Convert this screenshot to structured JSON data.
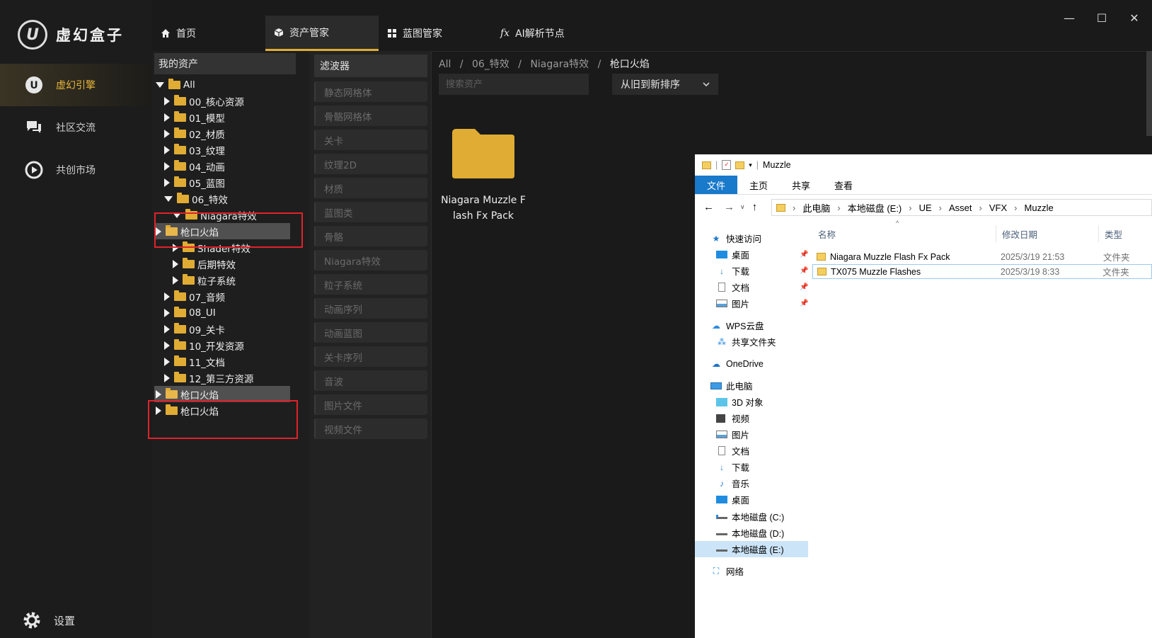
{
  "app": {
    "name": "虚幻盒子",
    "logo_glyph": "U"
  },
  "leftnav": {
    "items": [
      {
        "label": "虚幻引擎",
        "icon": "unreal-icon",
        "active": true
      },
      {
        "label": "社区交流",
        "icon": "chat-icon",
        "active": false
      },
      {
        "label": "共创市场",
        "icon": "market-icon",
        "active": false
      }
    ],
    "settings_label": "设置"
  },
  "tabs": [
    {
      "label": "首页",
      "icon": "home-icon",
      "active": false
    },
    {
      "label": "资产管家",
      "icon": "cube-icon",
      "active": true
    },
    {
      "label": "蓝图管家",
      "icon": "grid-icon",
      "active": false
    },
    {
      "label": "AI解析节点",
      "icon": "fx-icon",
      "active": false
    }
  ],
  "window_controls": {
    "minimize": "—",
    "maximize": "☐",
    "close": "✕"
  },
  "tree": {
    "header": "我的资产",
    "rows": [
      {
        "label": "All",
        "state": "open"
      },
      {
        "label": "00_核心资源",
        "state": "closed"
      },
      {
        "label": "01_模型",
        "state": "closed"
      },
      {
        "label": "02_材质",
        "state": "closed"
      },
      {
        "label": "03_纹理",
        "state": "closed"
      },
      {
        "label": "04_动画",
        "state": "closed"
      },
      {
        "label": "05_蓝图",
        "state": "closed"
      },
      {
        "label": "06_特效",
        "state": "open"
      },
      {
        "label": "Niagara特效",
        "state": "open"
      },
      {
        "label": "枪口火焰",
        "state": "closed"
      },
      {
        "label": "Shader特效",
        "state": "closed"
      },
      {
        "label": "后期特效",
        "state": "closed"
      },
      {
        "label": "粒子系统",
        "state": "closed"
      },
      {
        "label": "07_音频",
        "state": "closed"
      },
      {
        "label": "08_UI",
        "state": "closed"
      },
      {
        "label": "09_关卡",
        "state": "closed"
      },
      {
        "label": "10_开发资源",
        "state": "closed"
      },
      {
        "label": "11_文档",
        "state": "closed"
      },
      {
        "label": "12_第三方资源",
        "state": "closed"
      },
      {
        "label": "枪口火焰",
        "state": "closed"
      },
      {
        "label": "枪口火焰",
        "state": "closed"
      }
    ]
  },
  "filters": {
    "header": "滤波器",
    "items": [
      "静态网格体",
      "骨骼网格体",
      "关卡",
      "纹理2D",
      "材质",
      "蓝图类",
      "骨骼",
      "Niagara特效",
      "粒子系统",
      "动画序列",
      "动画蓝图",
      "关卡序列",
      "音波",
      "图片文件",
      "视频文件"
    ]
  },
  "content": {
    "breadcrumb": [
      "All",
      "06_特效",
      "Niagara特效",
      "枪口火焰"
    ],
    "breadcrumb_sep": "/",
    "search_placeholder": "搜索资产",
    "sort_label": "从旧到新排序",
    "assets": [
      {
        "label": "Niagara Muzzle Flash Fx Pack"
      }
    ]
  },
  "explorer": {
    "title": "Muzzle",
    "ribbon_tabs": [
      "文件",
      "主页",
      "共享",
      "查看"
    ],
    "path": [
      "此电脑",
      "本地磁盘 (E:)",
      "UE",
      "Asset",
      "VFX",
      "Muzzle"
    ],
    "nav_items": [
      {
        "label": "快速访问",
        "icon": "star-icon"
      },
      {
        "label": "桌面",
        "icon": "desktop-icon",
        "pinned": true
      },
      {
        "label": "下载",
        "icon": "download-icon",
        "pinned": true
      },
      {
        "label": "文档",
        "icon": "document-icon",
        "pinned": true
      },
      {
        "label": "图片",
        "icon": "picture-icon",
        "pinned": true
      },
      {
        "label": "WPS云盘",
        "icon": "cloud-icon"
      },
      {
        "label": "共享文件夹",
        "icon": "share-icon"
      },
      {
        "label": "OneDrive",
        "icon": "onedrive-icon"
      },
      {
        "label": "此电脑",
        "icon": "computer-icon"
      },
      {
        "label": "3D 对象",
        "icon": "3d-icon"
      },
      {
        "label": "视频",
        "icon": "video-icon"
      },
      {
        "label": "图片",
        "icon": "picture-icon"
      },
      {
        "label": "文档",
        "icon": "document-icon"
      },
      {
        "label": "下载",
        "icon": "download-icon"
      },
      {
        "label": "音乐",
        "icon": "music-icon"
      },
      {
        "label": "桌面",
        "icon": "desktop-icon"
      },
      {
        "label": "本地磁盘 (C:)",
        "icon": "drive-icon"
      },
      {
        "label": "本地磁盘 (D:)",
        "icon": "drive-icon"
      },
      {
        "label": "本地磁盘 (E:)",
        "icon": "drive-icon",
        "selected": true
      },
      {
        "label": "网络",
        "icon": "network-icon"
      }
    ],
    "columns": [
      "名称",
      "修改日期",
      "类型"
    ],
    "files": [
      {
        "name": "Niagara Muzzle Flash Fx Pack",
        "date": "2025/3/19 21:53",
        "type": "文件夹"
      },
      {
        "name": "TX075 Muzzle Flashes",
        "date": "2025/3/19 8:33",
        "type": "文件夹"
      }
    ]
  },
  "colors": {
    "accent": "#e0ac34",
    "highlight_box": "#e0222a",
    "explorer_blue": "#1979ca"
  }
}
